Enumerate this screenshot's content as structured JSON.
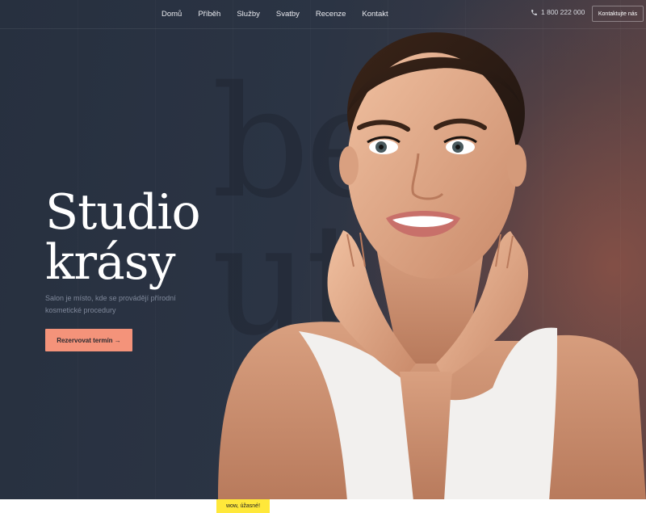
{
  "nav": {
    "links": [
      "Domů",
      "Příběh",
      "Služby",
      "Svatby",
      "Recenze",
      "Kontakt"
    ],
    "phone_icon": "phone-icon",
    "phone": "1 800 222 000",
    "contact_button": "Kontaktujte nás"
  },
  "hero": {
    "watermark_line1": "be",
    "watermark_line2": "ut",
    "title_line1": "Studio",
    "title_line2": "krásy",
    "subtitle": "Salon je místo, kde se provádějí přírodní kosmetické procedury",
    "cta_label": "Rezervovat termín →"
  },
  "footer": {
    "badge": "wow, úžasné!"
  },
  "colors": {
    "background": "#2c3545",
    "accent": "#f4937a",
    "badge": "#ffe83a"
  }
}
